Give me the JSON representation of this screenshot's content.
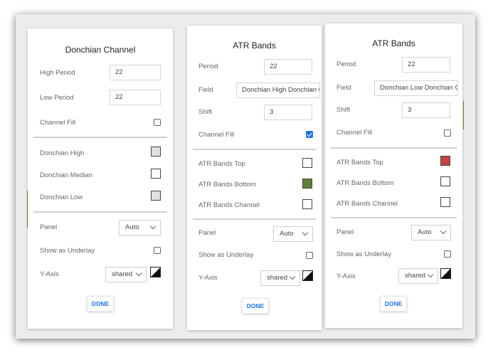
{
  "panels": {
    "donchian": {
      "title": "Donchian Channel",
      "high_period_label": "High Period",
      "high_period_value": "22",
      "low_period_label": "Low Period",
      "low_period_value": "22",
      "channel_fill_label": "Channel Fill",
      "donchian_high_label": "Donchian High",
      "donchian_median_label": "Donchian Median",
      "donchian_low_label": "Donchian Low",
      "panel_label": "Panel",
      "panel_value": "Auto",
      "underlay_label": "Show as Underlay",
      "yaxis_label": "Y-Axis",
      "yaxis_value": "shared",
      "done_label": "DONE",
      "colors": {
        "high": "#e0e0e0",
        "median": "#ffffff",
        "low": "#e0e0e0"
      }
    },
    "atr_top": {
      "title": "ATR Bands",
      "period_label": "Period",
      "period_value": "22",
      "field_label": "Field",
      "field_value": "Donchian High Donchian Ch",
      "shift_label": "Shift",
      "shift_value": "3",
      "channel_fill_label": "Channel Fill",
      "channel_fill_checked": true,
      "bands_top_label": "ATR Bands Top",
      "bands_bottom_label": "ATR Bands Bottom",
      "bands_channel_label": "ATR Bands Channel",
      "panel_label": "Panel",
      "panel_value": "Auto",
      "underlay_label": "Show as Underlay",
      "yaxis_label": "Y-Axis",
      "yaxis_value": "shared",
      "done_label": "DONE",
      "colors": {
        "top": "#ffffff",
        "bottom": "#5e7f36",
        "channel": "#ffffff"
      }
    },
    "atr_bottom": {
      "title": "ATR Bands",
      "period_label": "Period",
      "period_value": "22",
      "field_label": "Field",
      "field_value": "Donchian Low Donchian Ch",
      "shift_label": "Shift",
      "shift_value": "3",
      "channel_fill_label": "Channel Fill",
      "channel_fill_checked": false,
      "bands_top_label": "ATR Bands Top",
      "bands_bottom_label": "ATR Bands Bottom",
      "bands_channel_label": "ATR Bands Channel",
      "panel_label": "Panel",
      "panel_value": "Auto",
      "underlay_label": "Show as Underlay",
      "yaxis_label": "Y-Axis",
      "yaxis_value": "shared",
      "done_label": "DONE",
      "colors": {
        "top": "#c94040",
        "bottom": "#ffffff",
        "channel": "#ffffff"
      }
    }
  }
}
